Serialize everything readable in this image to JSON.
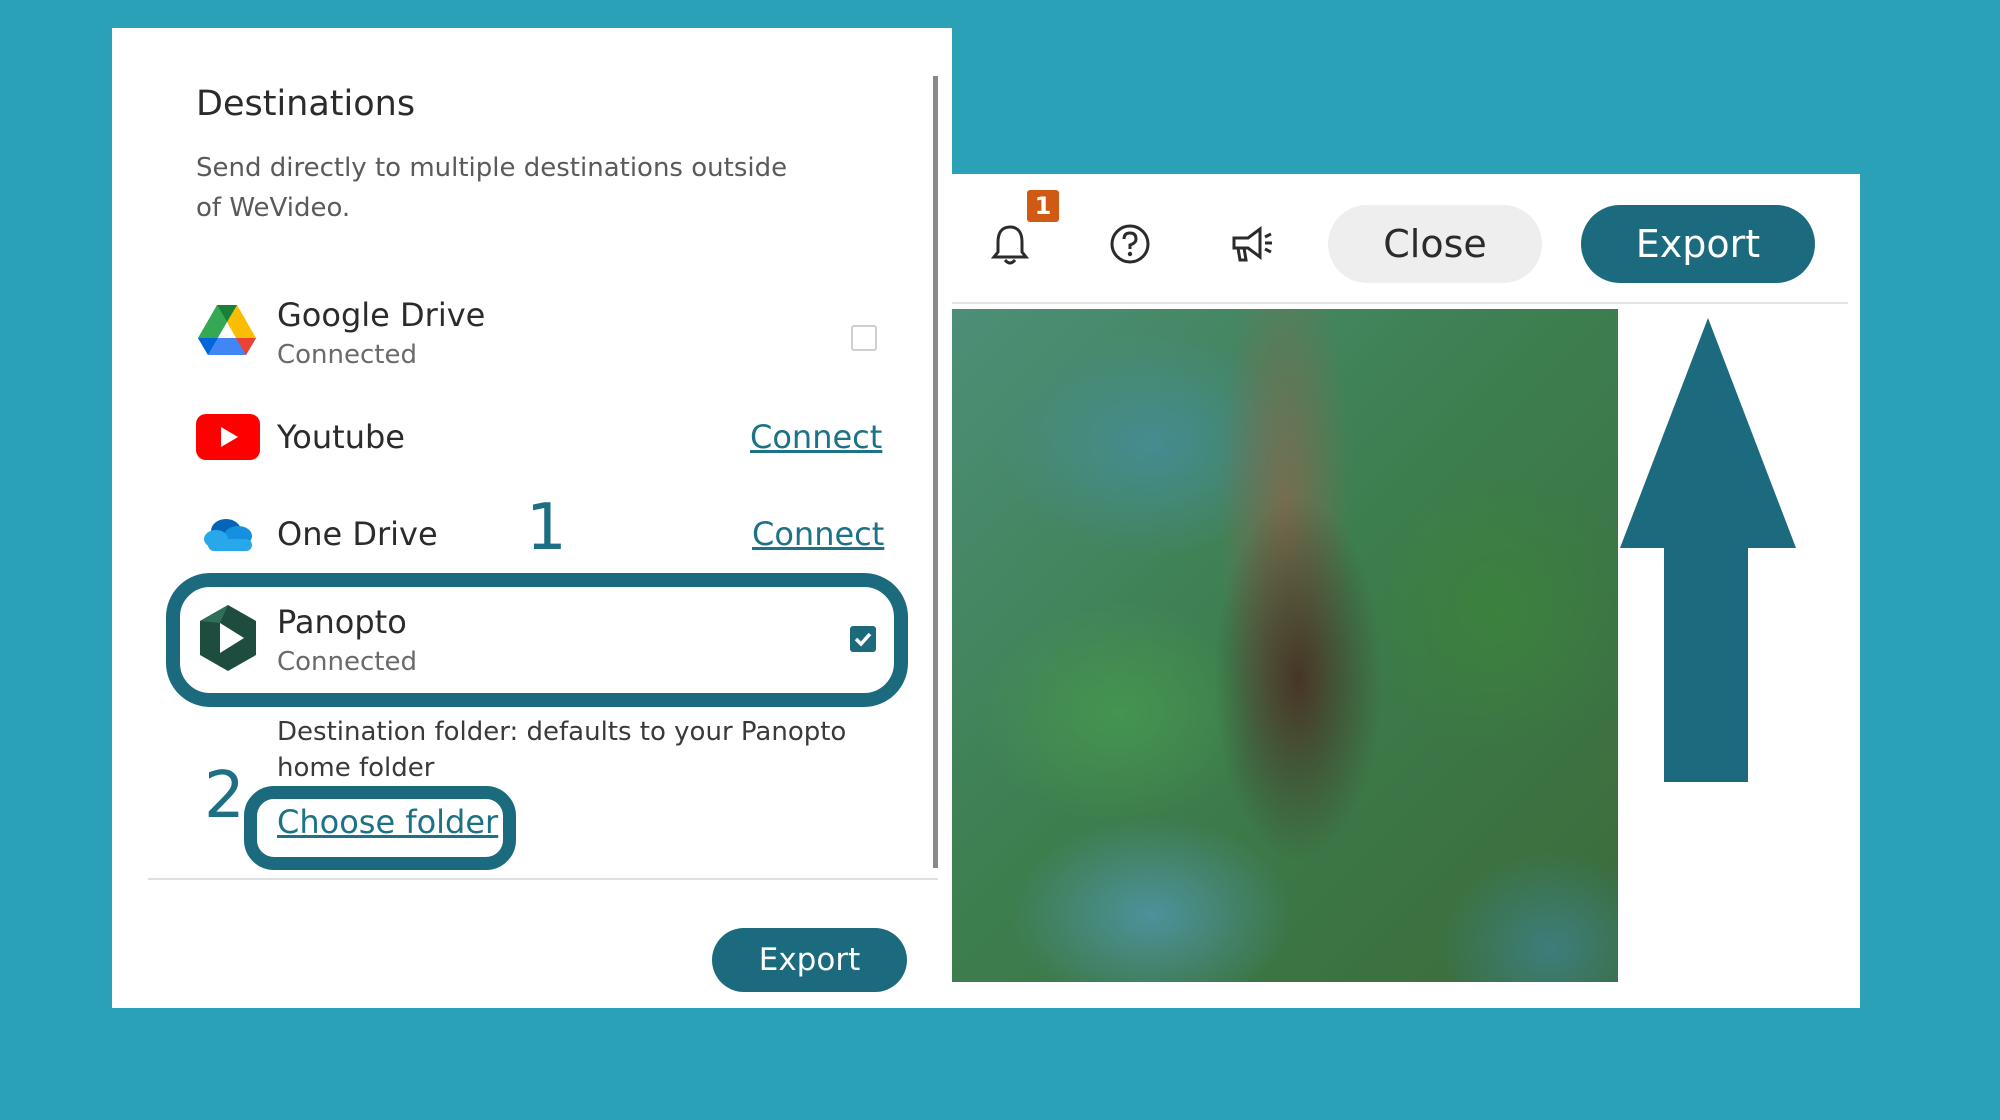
{
  "destinations_panel": {
    "title": "Destinations",
    "subtitle": "Send directly to multiple destinations outside of WeVideo.",
    "items": [
      {
        "name": "Google Drive",
        "status": "Connected",
        "icon": "google-drive-icon",
        "checked": false
      },
      {
        "name": "Youtube",
        "action": "Connect",
        "icon": "youtube-icon"
      },
      {
        "name": "One Drive",
        "action": "Connect",
        "icon": "onedrive-icon"
      },
      {
        "name": "Panopto",
        "status": "Connected",
        "icon": "panopto-icon",
        "checked": true
      }
    ],
    "folder_label": "Destination folder:",
    "folder_value": "defaults to your Panopto home folder",
    "choose_folder": "Choose folder",
    "export_button": "Export"
  },
  "annotations": {
    "step1": "1",
    "step2": "2",
    "highlight_color": "#1b6a7e",
    "arrow_color": "#1b6a7e"
  },
  "editor_toolbar": {
    "notification_count": "1",
    "close_button": "Close",
    "export_button": "Export",
    "icons": [
      "bell-icon",
      "help-icon",
      "megaphone-icon"
    ]
  },
  "colors": {
    "background": "#2aa1b6",
    "accent": "#1b6a7e",
    "badge": "#d05a14",
    "link": "#1d7385"
  }
}
